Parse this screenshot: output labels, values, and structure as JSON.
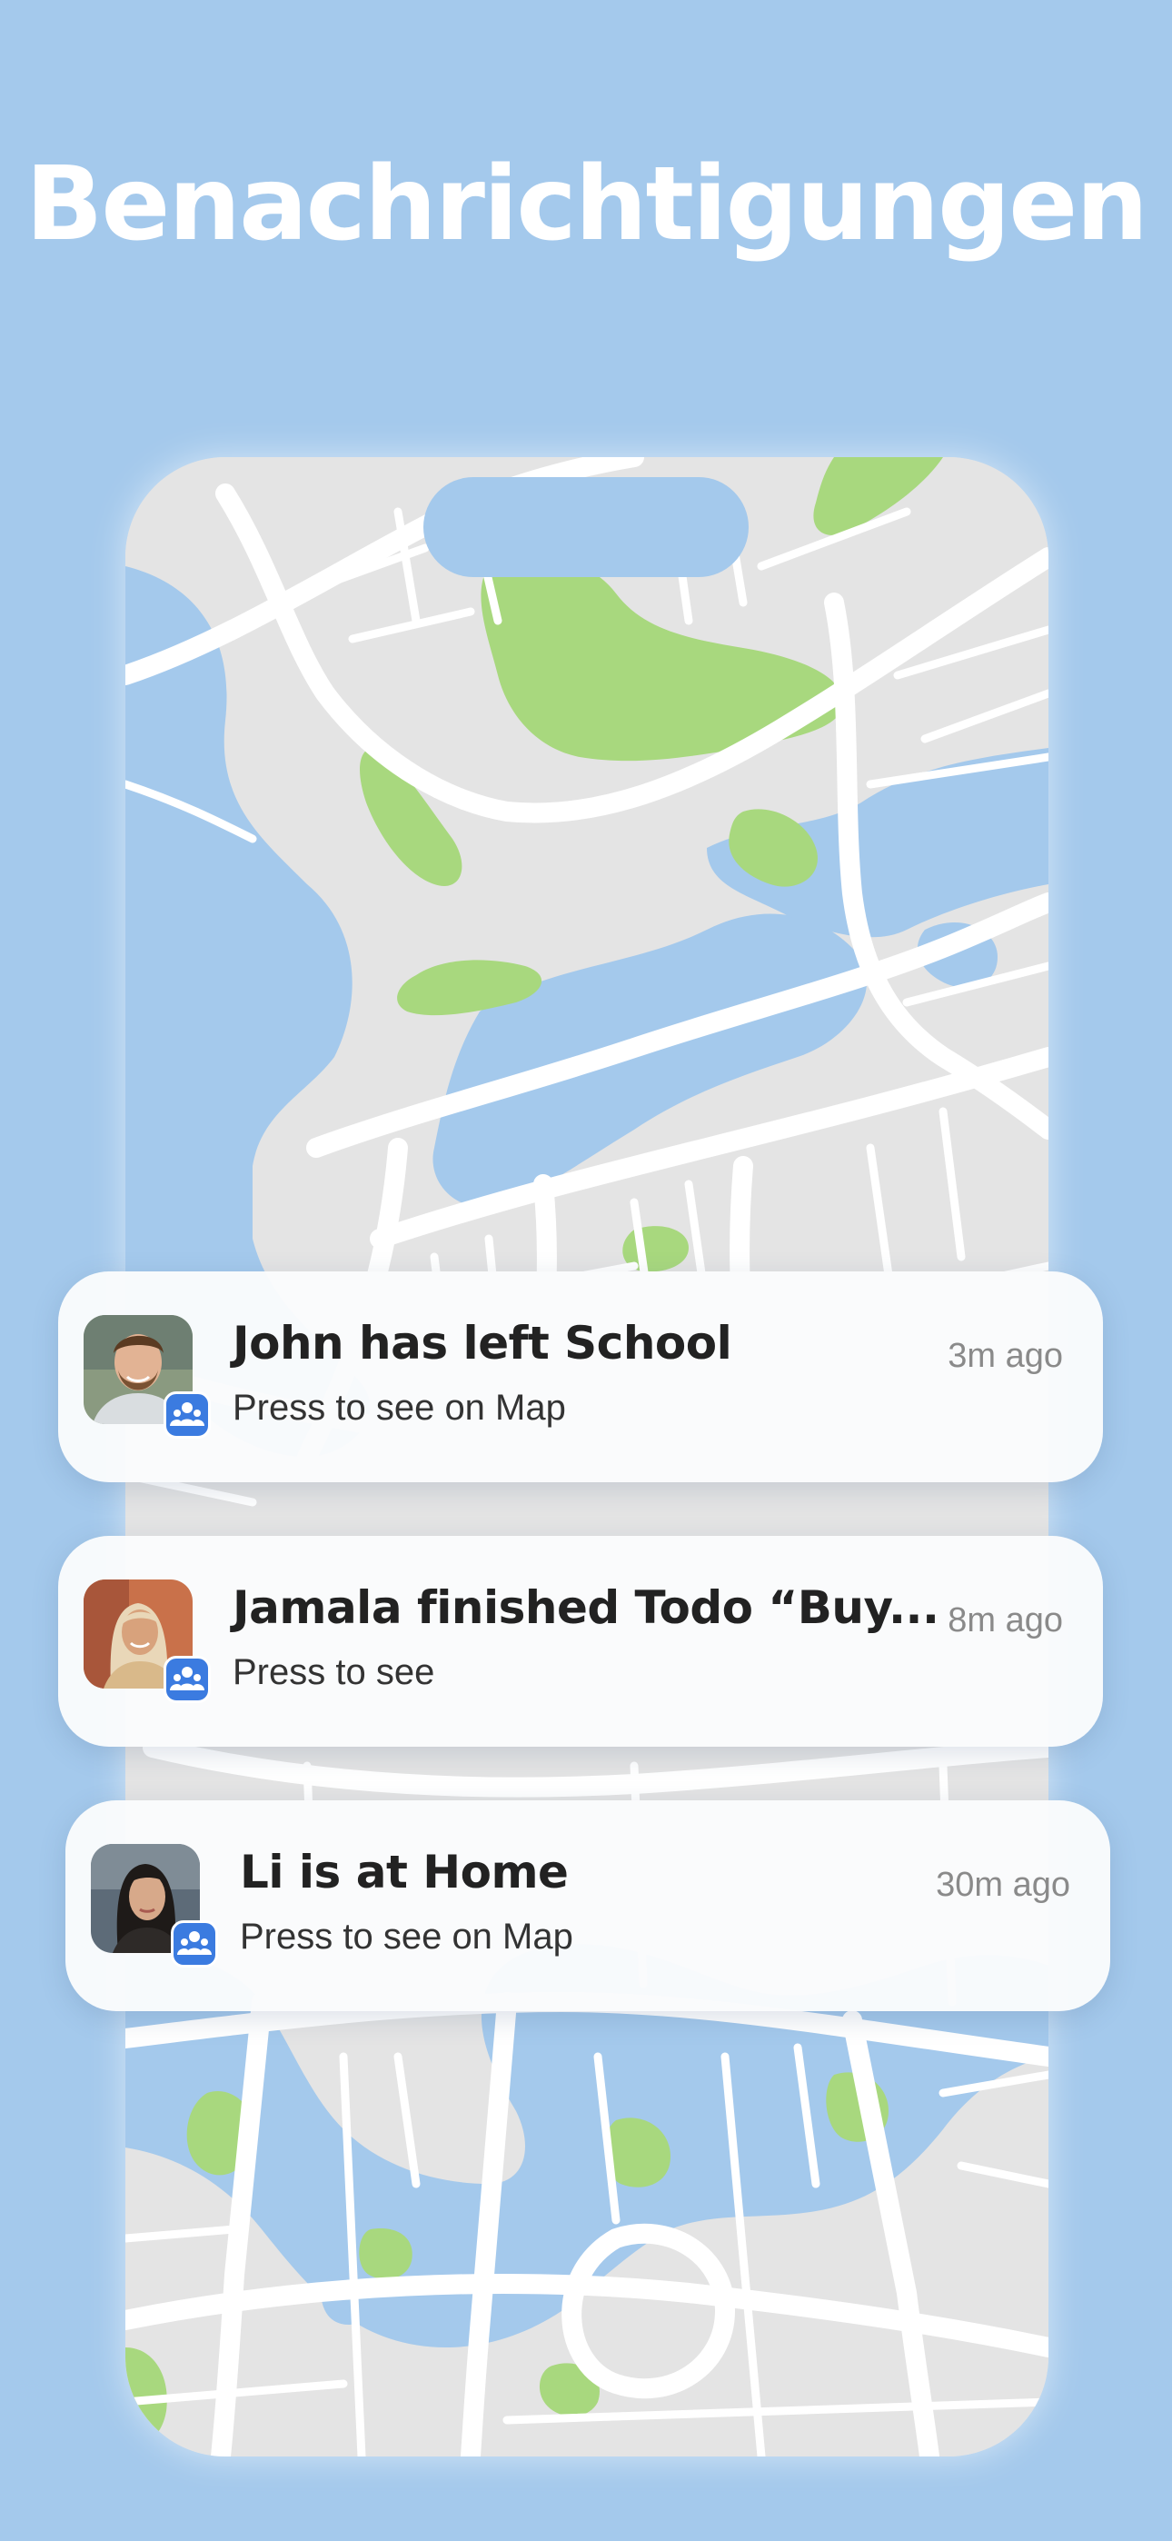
{
  "headline": "Benachrichtigungen",
  "colors": {
    "background": "#a4c9ec",
    "map_land": "#e4e4e4",
    "map_water": "#a4c9ec",
    "map_park": "#a8d87e",
    "map_road": "#ffffff",
    "card": "#fafbfc",
    "badge": "#3b7be0"
  },
  "notifications": [
    {
      "title": "John has left School",
      "subtitle": "Press to see on Map",
      "time": "3m ago",
      "avatar": "john-avatar",
      "badge_icon": "family-group-icon"
    },
    {
      "title": "Jamala finished Todo “Buy...",
      "subtitle": "Press to see",
      "time": "8m ago",
      "avatar": "jamala-avatar",
      "badge_icon": "family-group-icon"
    },
    {
      "title": "Li is at Home",
      "subtitle": "Press to see on Map",
      "time": "30m ago",
      "avatar": "li-avatar",
      "badge_icon": "family-group-icon"
    }
  ]
}
